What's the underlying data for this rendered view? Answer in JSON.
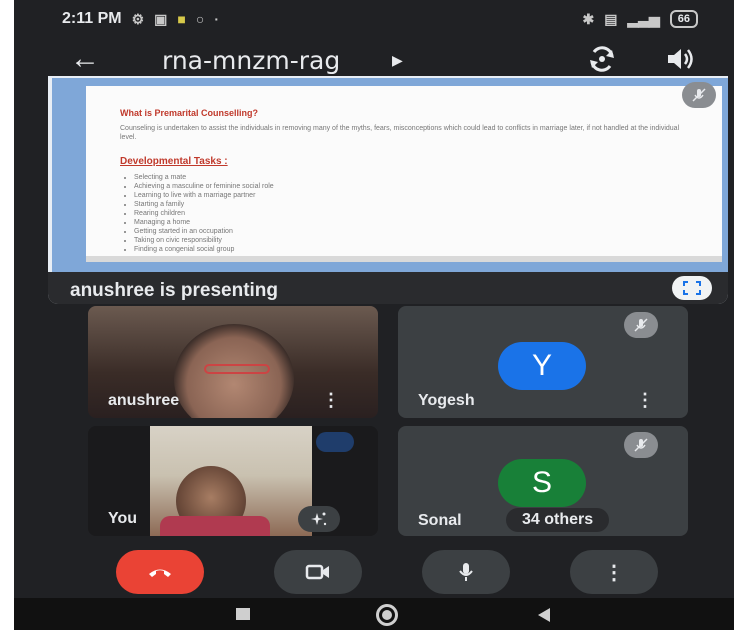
{
  "status_bar": {
    "time": "2:11 PM",
    "battery": "66"
  },
  "header": {
    "meeting_code": "rna-mnzm-rag"
  },
  "presentation": {
    "label": "anushree is presenting",
    "slide": {
      "heading": "What is Premarital Counselling?",
      "body": "Counseling is undertaken to assist the individuals in removing many of the myths, fears, misconceptions which could lead to conflicts in marriage later, if not handled at the individual level.",
      "subheading": "Developmental Tasks :",
      "items": [
        "Selecting a mate",
        "Achieving a masculine or feminine social role",
        "Learning to live with a marriage partner",
        "Starting a family",
        "Rearing children",
        "Managing a home",
        "Getting started in an occupation",
        "Taking on civic responsibility",
        "Finding a congenial social group"
      ]
    }
  },
  "participants": {
    "anushree": {
      "name": "anushree"
    },
    "yogesh": {
      "name": "Yogesh",
      "initial": "Y",
      "color": "#1a73e8"
    },
    "you": {
      "name": "You"
    },
    "sonal": {
      "name": "Sonal",
      "initial": "S",
      "color": "#188038",
      "others": "34 others"
    }
  },
  "colors": {
    "end_call": "#ea4335",
    "background": "#202124",
    "tile": "#3c4043"
  }
}
